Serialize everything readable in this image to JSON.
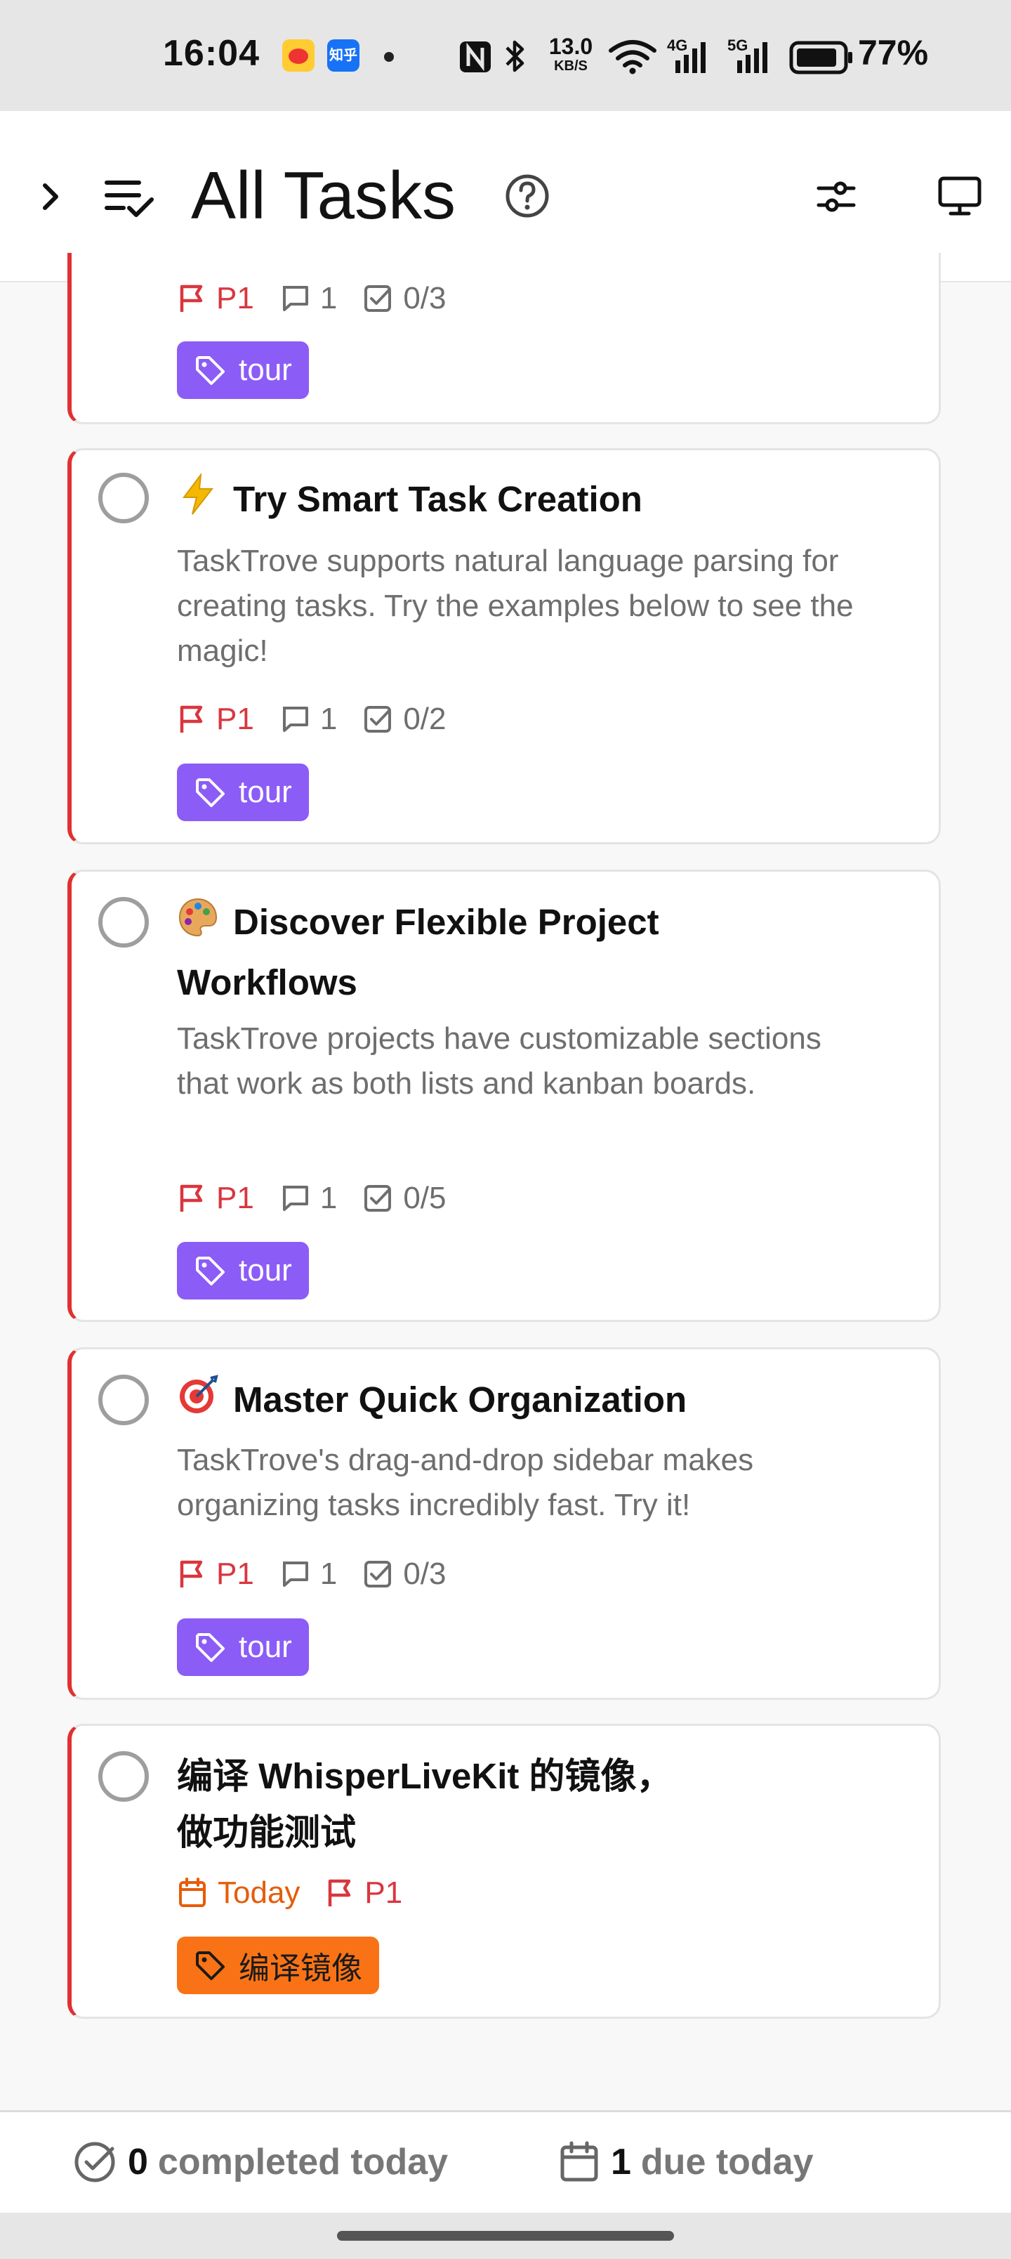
{
  "status_bar": {
    "time": "16:04",
    "zhihu_icon_text": "知乎",
    "network_speed_value": "13.0",
    "network_speed_unit": "KB/S",
    "signal_1": "4G",
    "signal_2": "5G",
    "battery": "77%"
  },
  "header": {
    "title": "All Tasks"
  },
  "tasks": [
    {
      "priority": "P1",
      "comments": "1",
      "subtasks": "0/3",
      "tag": "tour"
    },
    {
      "emoji": "⚡",
      "title": "Try Smart Task Creation",
      "description": "TaskTrove supports natural language parsing for creating tasks. Try the examples below to see the magic!",
      "priority": "P1",
      "comments": "1",
      "subtasks": "0/2",
      "tag": "tour"
    },
    {
      "emoji": "🎨",
      "title": "Discover Flexible Project Workflows",
      "description": "TaskTrove projects have customizable sections that work as both lists and kanban boards.",
      "priority": "P1",
      "comments": "1",
      "subtasks": "0/5",
      "tag": "tour"
    },
    {
      "emoji": "🎯",
      "title": "Master Quick Organization",
      "description": "TaskTrove's drag-and-drop sidebar makes organizing tasks incredibly fast. Try it!",
      "priority": "P1",
      "comments": "1",
      "subtasks": "0/3",
      "tag": "tour"
    },
    {
      "title": "编译 WhisperLiveKit 的镜像，做功能测试",
      "due": "Today",
      "priority": "P1",
      "tag": "编译镜像"
    }
  ],
  "footer": {
    "completed_count": "0",
    "completed_label": "completed today",
    "due_count": "1",
    "due_label": "due today"
  },
  "colors": {
    "priority_red": "#e03131",
    "tag_purple": "#8b5cf6",
    "tag_orange": "#f97316",
    "due_orange": "#e65c0a"
  }
}
